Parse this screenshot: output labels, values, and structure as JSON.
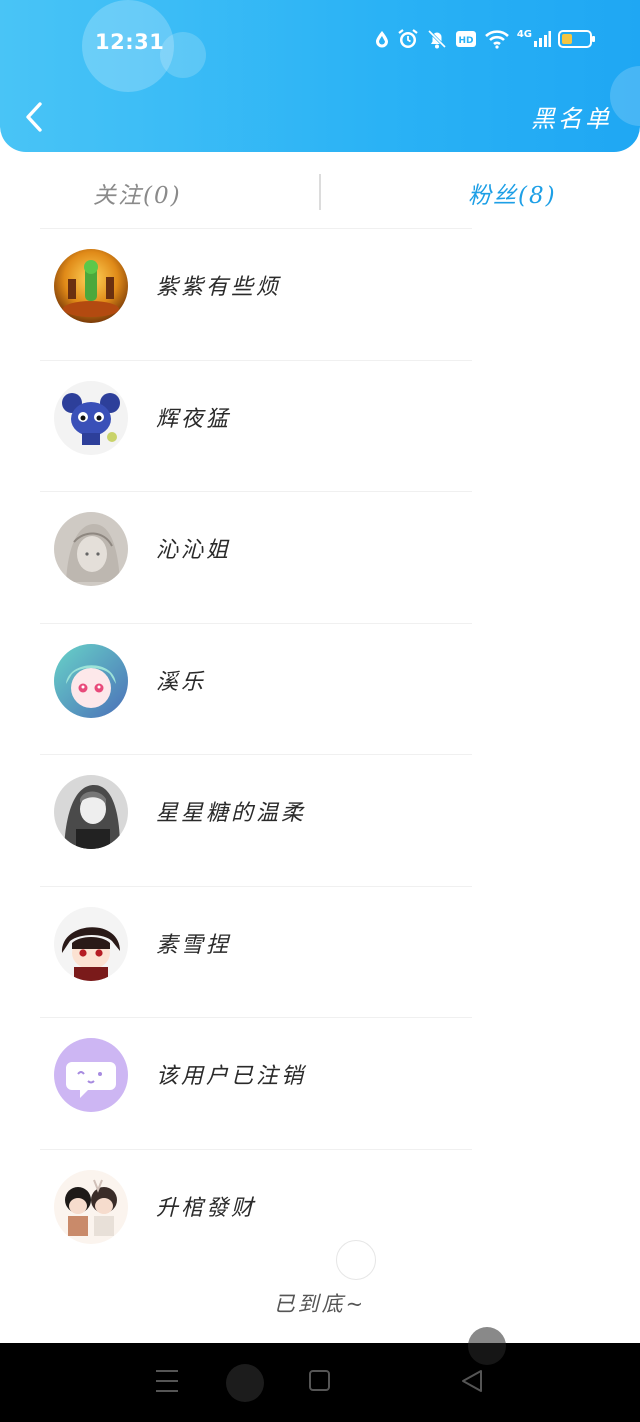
{
  "status_bar": {
    "time": "12:31",
    "network": "4G"
  },
  "header": {
    "blacklist_label": "黑名单"
  },
  "tabs": [
    {
      "label": "关注(0)",
      "active": false
    },
    {
      "label": "粉丝(8)",
      "active": true
    }
  ],
  "fans": [
    {
      "name": "紫紫有些烦"
    },
    {
      "name": "辉夜猛"
    },
    {
      "name": "沁沁姐"
    },
    {
      "name": "溪乐"
    },
    {
      "name": "星星糖的温柔"
    },
    {
      "name": "素雪捏"
    },
    {
      "name": "该用户已注销"
    },
    {
      "name": "升棺發财"
    }
  ],
  "footer": {
    "end_text": "已到底~"
  },
  "colors": {
    "header_start": "#49c4f6",
    "header_end": "#1fa7f3",
    "active_tab": "#1d9fe6",
    "inactive_tab": "#8a8a8a"
  }
}
